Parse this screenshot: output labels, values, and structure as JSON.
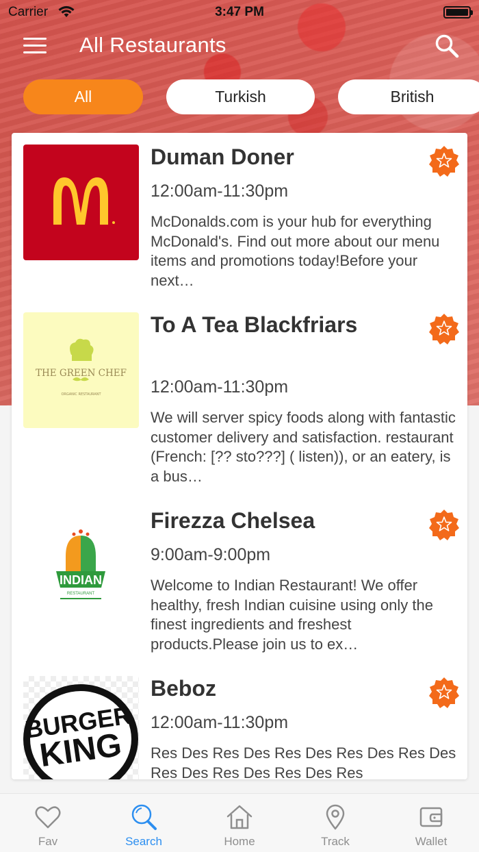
{
  "status_bar": {
    "carrier": "Carrier",
    "time": "3:47 PM"
  },
  "header": {
    "title": "All Restaurants"
  },
  "filters": [
    {
      "label": "All",
      "active": true
    },
    {
      "label": "Turkish",
      "active": false
    },
    {
      "label": "British",
      "active": false
    }
  ],
  "restaurants": [
    {
      "name": "Duman Doner",
      "hours": "12:00am-11:30pm",
      "description": "McDonalds.com is your hub for everything McDonald's. Find out more about our menu items and promotions today!Before your next…",
      "logo": "mcdonalds-logo"
    },
    {
      "name": "To A Tea Blackfriars",
      "hours": "12:00am-11:30pm",
      "description": "We will server spicy foods along with fantastic customer delivery and satisfaction. restaurant (French: [?? sto???] ( listen)), or an eatery, is a bus…",
      "logo": "green-chef-logo",
      "logo_text": "THE GREEN CHEF",
      "logo_subtext": "ORGANIC RESTAURANT"
    },
    {
      "name": "Firezza Chelsea",
      "hours": "9:00am-9:00pm",
      "description": "Welcome to Indian Restaurant! We offer healthy, fresh Indian cuisine using only the finest ingredients and freshest products.Please join us to ex…",
      "logo": "indian-restaurant-logo",
      "logo_text": "INDIAN",
      "logo_subtext": "RESTAURANT"
    },
    {
      "name": "Beboz",
      "hours": "12:00am-11:30pm",
      "description": "Res Des  Res Des  Res Des  Res Des Res Des  Res Des Res Des  Res Des Res",
      "logo": "burger-king-logo",
      "logo_text_1": "BURGER",
      "logo_text_2": "KING"
    }
  ],
  "tab_bar": [
    {
      "label": "Fav",
      "icon": "heart-icon",
      "active": false
    },
    {
      "label": "Search",
      "icon": "search-icon",
      "active": true
    },
    {
      "label": "Home",
      "icon": "home-icon",
      "active": false
    },
    {
      "label": "Track",
      "icon": "location-pin-icon",
      "active": false
    },
    {
      "label": "Wallet",
      "icon": "wallet-icon",
      "active": false
    }
  ],
  "colors": {
    "accent": "#f7861b",
    "active_tab": "#2d8ff0",
    "star": "#f36a1a"
  }
}
